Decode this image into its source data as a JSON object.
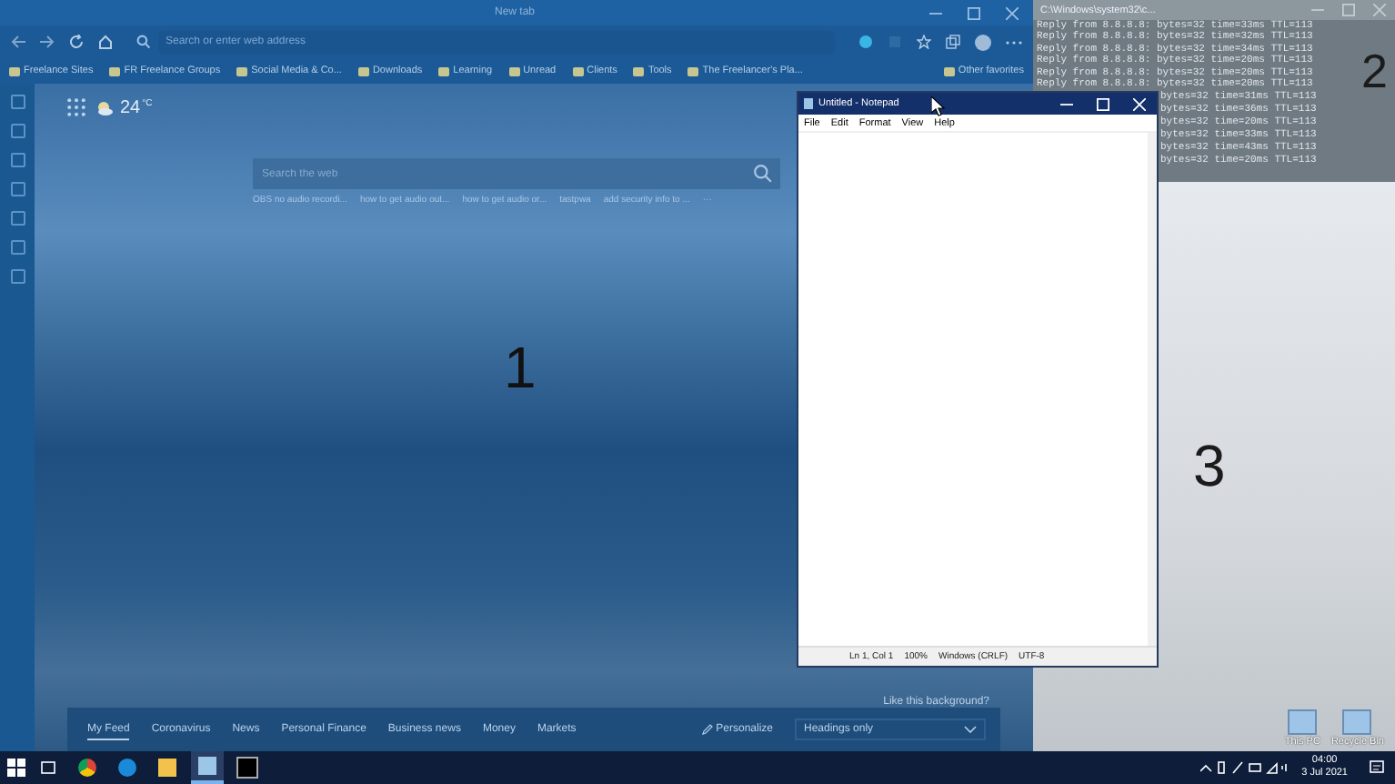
{
  "browser": {
    "title": "New tab",
    "address_placeholder": "Search or enter web address",
    "bookmarks": [
      "Freelance Sites",
      "FR Freelance Groups",
      "Social Media & Co...",
      "Downloads",
      "Learning",
      "Unread",
      "Clients",
      "Tools",
      "The Freelancer's Pla..."
    ],
    "other_favorites": "Other favorites",
    "weather": {
      "temp": "24",
      "unit": "°C"
    },
    "search_placeholder": "Search the web",
    "suggestions": [
      "OBS no audio recordi...",
      "how to get audio out...",
      "how to get audio or...",
      "tastpwa",
      "add security info to ...",
      "···"
    ],
    "background_prompt": "Like this background?",
    "feed_tabs": [
      {
        "label": "My Feed",
        "selected": true
      },
      {
        "label": "Coronavirus",
        "selected": false
      },
      {
        "label": "News",
        "selected": false
      },
      {
        "label": "Personal Finance",
        "selected": false
      },
      {
        "label": "Business news",
        "selected": false
      },
      {
        "label": "Money",
        "selected": false
      },
      {
        "label": "Markets",
        "selected": false
      }
    ],
    "personalize": "Personalize",
    "layout_select": "Headings only"
  },
  "console": {
    "title": "C:\\Windows\\system32\\c...",
    "lines": [
      "Reply from 8.8.8.8: bytes=32 time=33ms TTL=113",
      "Reply from 8.8.8.8: bytes=32 time=32ms TTL=113",
      "Reply from 8.8.8.8: bytes=32 time=34ms TTL=113",
      "Reply from 8.8.8.8: bytes=32 time=20ms TTL=113",
      "Reply from 8.8.8.8: bytes=32 time=20ms TTL=113",
      "Reply from 8.8.8.8: bytes=32 time=20ms TTL=113"
    ],
    "partial_lines": [
      "bytes=32 time=31ms TTL=113",
      "bytes=32 time=36ms TTL=113",
      "bytes=32 time=20ms TTL=113",
      "bytes=32 time=33ms TTL=113",
      "bytes=32 time=43ms TTL=113",
      "bytes=32 time=20ms TTL=113"
    ]
  },
  "notepad": {
    "title": "Untitled - Notepad",
    "menu": [
      "File",
      "Edit",
      "Format",
      "View",
      "Help"
    ],
    "status": [
      "Ln 1, Col 1",
      "100%",
      "Windows (CRLF)",
      "UTF-8"
    ]
  },
  "desktop_icons": [
    "This PC",
    "Recycle Bin"
  ],
  "zone_labels": [
    "1",
    "2",
    "3"
  ],
  "taskbar": {
    "apps": [
      {
        "kind": "chrome",
        "active": false
      },
      {
        "kind": "edge",
        "active": false
      },
      {
        "kind": "explorer",
        "active": false
      },
      {
        "kind": "notepad",
        "active": true
      },
      {
        "kind": "console",
        "active": false
      }
    ],
    "time": "04:00",
    "date": "3 Jul 2021"
  }
}
